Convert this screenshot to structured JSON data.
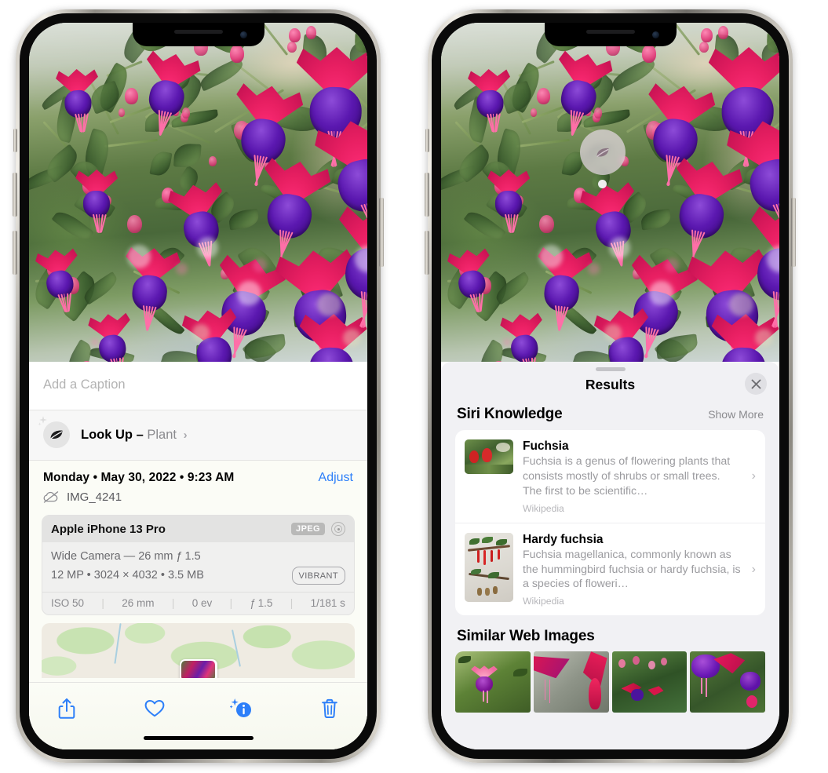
{
  "left_phone": {
    "name": "photos-detail-screen",
    "caption": {
      "placeholder": "Add a Caption",
      "value": ""
    },
    "lookup": {
      "icon": "leaf-icon",
      "sparkles_icon": "sparkles-icon",
      "label": "Look Up –",
      "subject": "Plant",
      "chevron": "›"
    },
    "meta": {
      "date": "Monday • May 30, 2022 • 9:23 AM",
      "adjust_label": "Adjust",
      "cloud_icon": "cloud-slash-icon",
      "filename": "IMG_4241"
    },
    "exif": {
      "device": "Apple iPhone 13 Pro",
      "format_badge": "JPEG",
      "hdr_icon": "hdr-ring-icon",
      "lens_line": "Wide Camera — 26 mm ƒ 1.5",
      "size_line": "12 MP • 3024 × 4032 • 3.5 MB",
      "style_badge": "VIBRANT",
      "stats": [
        "ISO 50",
        "26 mm",
        "0 ev",
        "ƒ 1.5",
        "1/181 s"
      ]
    },
    "map": {
      "name": "location-map-thumbnail",
      "pin": "photo-pin"
    },
    "toolbar": [
      {
        "name": "share-button",
        "icon": "share-icon"
      },
      {
        "name": "favorite-button",
        "icon": "heart-icon"
      },
      {
        "name": "info-button",
        "icon": "info-sparkle-icon"
      },
      {
        "name": "delete-button",
        "icon": "trash-icon"
      }
    ]
  },
  "right_phone": {
    "name": "visual-look-up-results-screen",
    "badge": {
      "name": "visual-lookup-badge",
      "icon": "leaf-icon"
    },
    "panel": {
      "grabber": "drag-handle",
      "title": "Results",
      "close_icon": "close-icon"
    },
    "siri_knowledge": {
      "heading": "Siri Knowledge",
      "show_more": "Show More",
      "items": [
        {
          "title": "Fuchsia",
          "description": "Fuchsia is a genus of flowering plants that consists mostly of shrubs or small trees. The first to be scientific…",
          "source": "Wikipedia",
          "thumb": "fuchsia-red-flowers-thumbnail",
          "chevron": "›"
        },
        {
          "title": "Hardy fuchsia",
          "description": "Fuchsia magellanica, commonly known as the hummingbird fuchsia or hardy fuchsia, is a species of floweri…",
          "source": "Wikipedia",
          "thumb": "hardy-fuchsia-specimen-thumbnail",
          "chevron": "›"
        }
      ]
    },
    "similar_web_images": {
      "heading": "Similar Web Images",
      "items": [
        "fuchsia-pink-purple-bloom-thumbnail",
        "fuchsia-red-closeup-thumbnail",
        "fuchsia-bush-buds-thumbnail",
        "fuchsia-purple-magenta-thumbnail"
      ]
    }
  },
  "colors": {
    "accent_blue": "#2d7ff9",
    "panel_bg": "#f1f1f4",
    "sheet_bg": "#fbfcf6",
    "card_bg": "#ffffff",
    "secondary_text": "#8a8a8e"
  }
}
